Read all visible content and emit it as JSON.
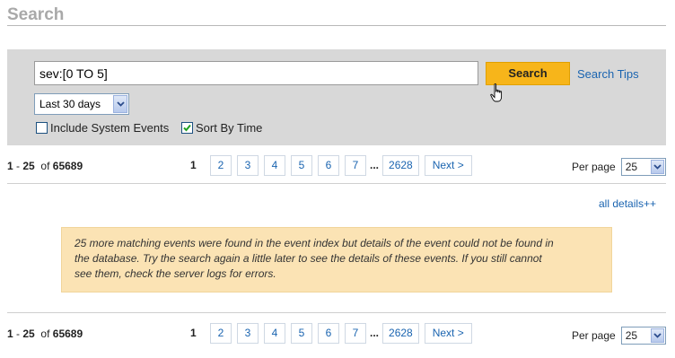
{
  "page": {
    "title": "Search"
  },
  "search": {
    "query": "sev:[0 TO 5]",
    "button_label": "Search",
    "tips_label": "Search Tips",
    "time_range": "Last 30 days",
    "include_system_events": {
      "label": "Include System Events",
      "checked": false
    },
    "sort_by_time": {
      "label": "Sort By Time",
      "checked": true
    }
  },
  "results": {
    "range_start": "1",
    "range_sep": "-",
    "range_end": "25",
    "of_label": "of",
    "total": "65689",
    "current_page": "1",
    "pages": [
      "2",
      "3",
      "4",
      "5",
      "6",
      "7"
    ],
    "ellipsis": "...",
    "last_page": "2628",
    "next_label": "Next >",
    "per_page_label": "Per page",
    "per_page_value": "25",
    "all_details_label": "all details++"
  },
  "notice": {
    "line1": "25 more matching events were found in the event index but details of the event could not be found in",
    "line2": "the database. Try the search again a little later to see the details of these events. If you still cannot",
    "line3": "see them, check the server logs for errors."
  },
  "colors": {
    "accent_button": "#f7b51a",
    "link": "#1a64b0",
    "panel_bg": "#d8d8d8",
    "notice_bg": "#fbe3b4"
  }
}
